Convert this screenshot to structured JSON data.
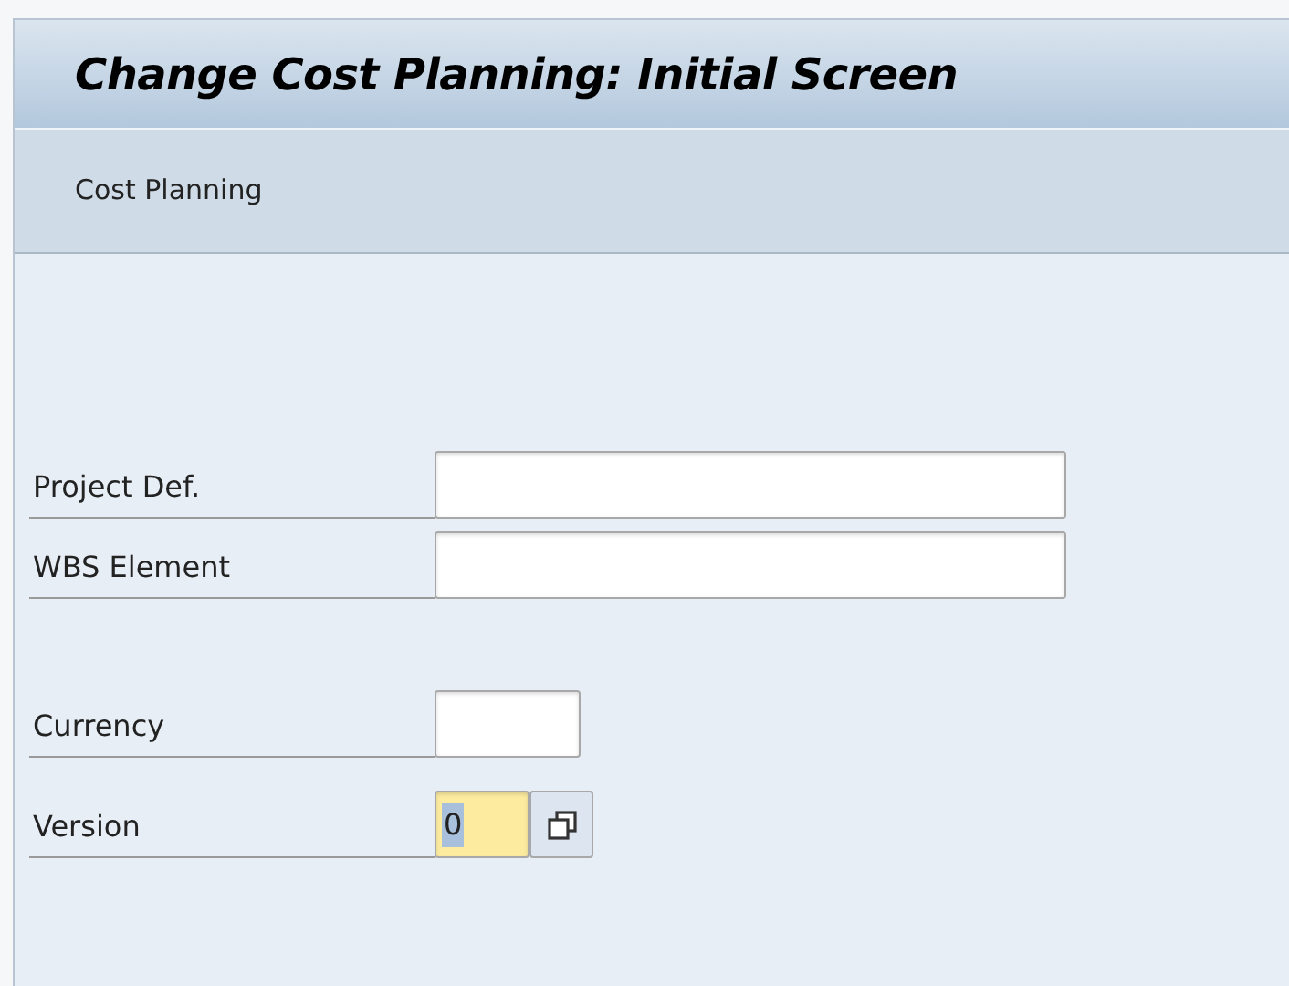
{
  "window": {
    "title": "Change Cost Planning: Initial Screen"
  },
  "toolbar": {
    "items": [
      "Cost Planning"
    ]
  },
  "fields": [
    {
      "label": "Project Def.",
      "kind": "long",
      "focused": false
    },
    {
      "label": "WBS Element",
      "kind": "long",
      "focused": false
    },
    {
      "label": "Currency",
      "kind": "short",
      "focused": false
    },
    {
      "label": "Version",
      "kind": "search_help",
      "value": "0",
      "focused": true
    }
  ]
}
